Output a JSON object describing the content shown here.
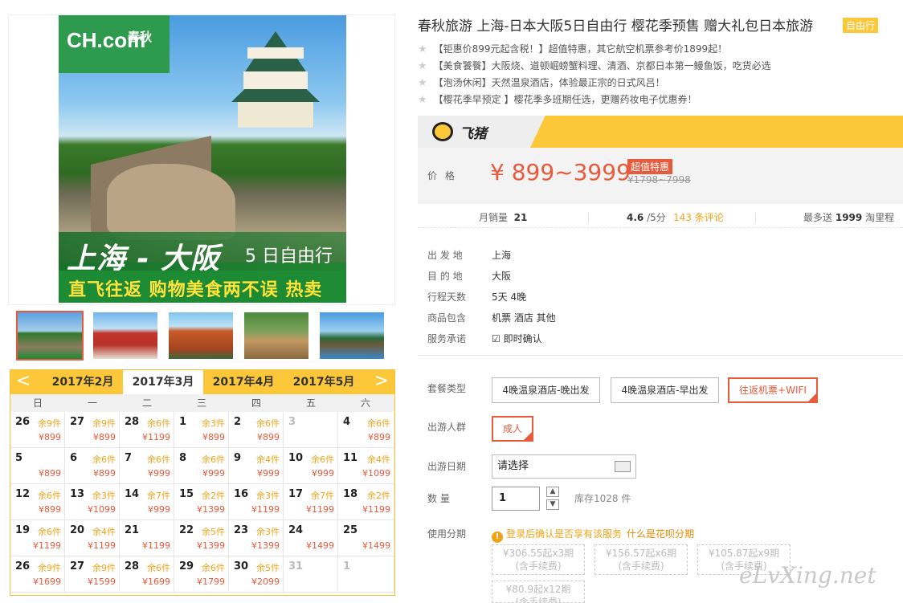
{
  "gallery": {
    "logo_text": "CH.com",
    "logo_cn": "春秋",
    "banner_route": "上海 - 大阪",
    "banner_days": "5 日自由行",
    "banner_sub": "直飞往返 购物美食两不误 热卖",
    "thumbnails": [
      "大阪城",
      "神社",
      "五重塔",
      "奈良鹿",
      "庭园"
    ]
  },
  "calendar": {
    "prev": "<",
    "next": ">",
    "months": [
      "2017年2月",
      "2017年3月",
      "2017年4月",
      "2017年5月"
    ],
    "active_month": 1,
    "weekdays": [
      "日",
      "一",
      "二",
      "三",
      "四",
      "五",
      "六"
    ],
    "days": [
      {
        "d": "26",
        "s": "余9件",
        "p": "¥899"
      },
      {
        "d": "27",
        "s": "余9件",
        "p": "¥899"
      },
      {
        "d": "28",
        "s": "余6件",
        "p": "¥1199"
      },
      {
        "d": "1",
        "s": "余3件",
        "p": "¥899"
      },
      {
        "d": "2",
        "s": "余6件",
        "p": "¥899"
      },
      {
        "d": "3",
        "s": "",
        "p": "",
        "dis": true
      },
      {
        "d": "4",
        "s": "余6件",
        "p": "¥899"
      },
      {
        "d": "5",
        "s": "",
        "p": "¥899"
      },
      {
        "d": "6",
        "s": "余6件",
        "p": "¥899"
      },
      {
        "d": "7",
        "s": "余6件",
        "p": "¥999"
      },
      {
        "d": "8",
        "s": "余6件",
        "p": "¥999"
      },
      {
        "d": "9",
        "s": "余4件",
        "p": "¥999"
      },
      {
        "d": "10",
        "s": "余6件",
        "p": "¥999"
      },
      {
        "d": "11",
        "s": "余4件",
        "p": "¥1099"
      },
      {
        "d": "12",
        "s": "余6件",
        "p": "¥899"
      },
      {
        "d": "13",
        "s": "余3件",
        "p": "¥1099"
      },
      {
        "d": "14",
        "s": "余7件",
        "p": "¥999"
      },
      {
        "d": "15",
        "s": "余2件",
        "p": "¥1399"
      },
      {
        "d": "16",
        "s": "余3件",
        "p": "¥1199"
      },
      {
        "d": "17",
        "s": "余7件",
        "p": "¥1199"
      },
      {
        "d": "18",
        "s": "余2件",
        "p": "¥1199"
      },
      {
        "d": "19",
        "s": "余6件",
        "p": "¥1199"
      },
      {
        "d": "20",
        "s": "余4件",
        "p": "¥1199"
      },
      {
        "d": "21",
        "s": "",
        "p": "¥1199"
      },
      {
        "d": "22",
        "s": "余5件",
        "p": "¥1399"
      },
      {
        "d": "23",
        "s": "余3件",
        "p": "¥1399"
      },
      {
        "d": "24",
        "s": "",
        "p": "¥1499"
      },
      {
        "d": "25",
        "s": "",
        "p": "¥1499"
      },
      {
        "d": "26",
        "s": "余9件",
        "p": "¥1699"
      },
      {
        "d": "27",
        "s": "余9件",
        "p": "¥1599"
      },
      {
        "d": "28",
        "s": "余6件",
        "p": "¥1699"
      },
      {
        "d": "29",
        "s": "余6件",
        "p": "¥1799"
      },
      {
        "d": "30",
        "s": "余5件",
        "p": "¥2099"
      },
      {
        "d": "31",
        "s": "",
        "p": "",
        "dis": true
      },
      {
        "d": "1",
        "s": "",
        "p": "",
        "dis": true
      }
    ]
  },
  "product": {
    "title": "春秋旅游 上海-日本大阪5日自由行 樱花季预售 赠大礼包日本旅游",
    "tag": "自由行",
    "features": [
      "【钜惠价899元起含税！】超值特惠，其它航空机票参考价1899起！",
      "【美食饕餮】大阪烧、道顿崛螃蟹料理、清酒、京都日本第一鳗鱼饭，吃货必选",
      "【泡汤休闲】天然温泉酒店，体验最正宗的日式风吕！",
      "【樱花季早预定 】樱花季多班期任选，更赠药妆电子优惠券！"
    ],
    "feature_star": "★"
  },
  "fliggy": {
    "name": "飞猪"
  },
  "price": {
    "label": "价格",
    "range": "¥ 899~3999",
    "badge": "超值特惠",
    "original": "¥1798~7998"
  },
  "stats": {
    "sales_label": "月销量",
    "sales_value": "21",
    "rating_value": "4.6",
    "rating_suffix": "/5分",
    "reviews": "143 条评论",
    "mileage_label": "最多送",
    "mileage_value": "1999",
    "mileage_suffix": "淘里程"
  },
  "info": [
    {
      "k": "出 发 地",
      "v": "上海"
    },
    {
      "k": "目 的 地",
      "v": "大阪"
    },
    {
      "k": "行程天数",
      "v": "5天 4晚"
    },
    {
      "k": "商品包含",
      "v": "机票  酒店  其他"
    },
    {
      "k": "服务承诺",
      "v": "即时确认"
    }
  ],
  "options": {
    "package_label": "套餐类型",
    "packages": [
      "4晚温泉酒店-晚出发",
      "4晚温泉酒店-早出发",
      "往返机票+WIFI"
    ],
    "selected_package": 2,
    "people_label": "出游人群",
    "people": [
      "成人"
    ],
    "date_label": "出游日期",
    "date_placeholder": "请选择",
    "qty_label": "数   量",
    "qty_value": "1",
    "stock": "库存1028 件",
    "installment_label": "使用分期",
    "installment_notice": "登录后确认是否享有该服务",
    "installment_link": "什么是花呗分期",
    "installments": [
      {
        "amt": "¥306.55起x3期",
        "fee": "(含手续费)"
      },
      {
        "amt": "¥156.57起x6期",
        "fee": "(含手续费)"
      },
      {
        "amt": "¥105.87起x9期",
        "fee": "(含手续费)"
      },
      {
        "amt": "¥80.9起x12期",
        "fee": "(含手续费)"
      }
    ]
  },
  "watermark": "eLvXing.net",
  "colors": {
    "accent": "#e85a3c",
    "yellow": "#fcc83a",
    "orange": "#f0a318"
  }
}
